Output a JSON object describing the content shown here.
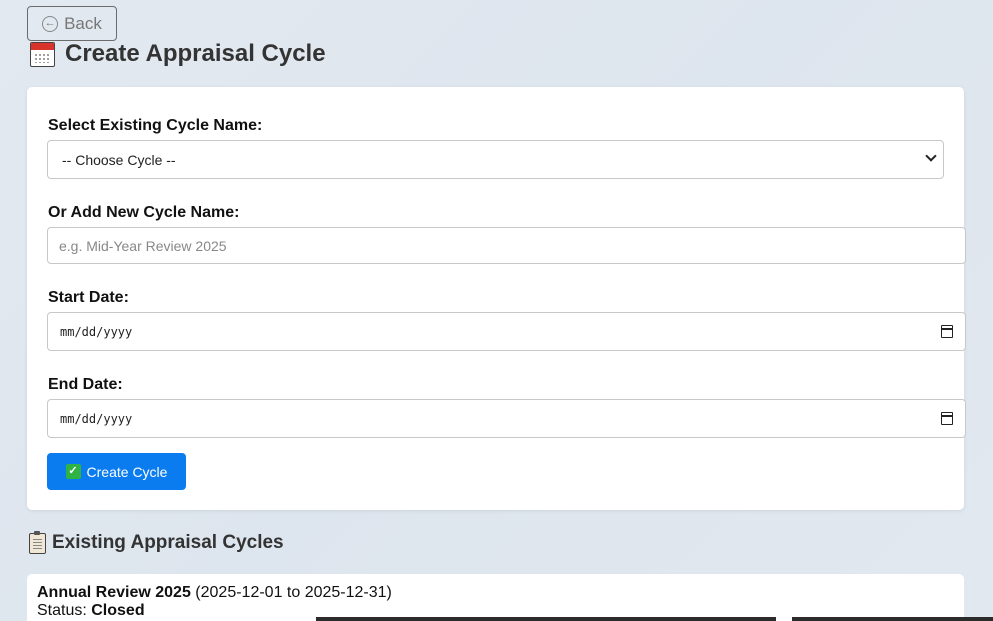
{
  "back_button": {
    "label": "Back",
    "icon": "arrow-left-circle-icon"
  },
  "page_title": {
    "icon": "calendar-icon",
    "text": "Create Appraisal Cycle"
  },
  "form": {
    "existing_label": "Select Existing Cycle Name:",
    "existing_select_value": "-- Choose Cycle --",
    "new_label": "Or Add New Cycle Name:",
    "new_placeholder": "e.g. Mid-Year Review 2025",
    "start_label": "Start Date:",
    "start_value": "mm/dd/yyyy",
    "end_label": "End Date:",
    "end_value": "mm/dd/yyyy",
    "submit_label": "Create Cycle",
    "submit_icon": "check-mark-icon"
  },
  "existing_section": {
    "icon": "clipboard-icon",
    "title": "Existing Appraisal Cycles",
    "cycles": [
      {
        "name": "Annual Review 2025",
        "range": " (2025-12-01 to 2025-12-31)",
        "status_label": "Status: ",
        "status": "Closed"
      }
    ]
  },
  "colors": {
    "primary_button": "#0a7cf0",
    "check_green": "#2fb344",
    "calendar_red": "#d9342b"
  }
}
